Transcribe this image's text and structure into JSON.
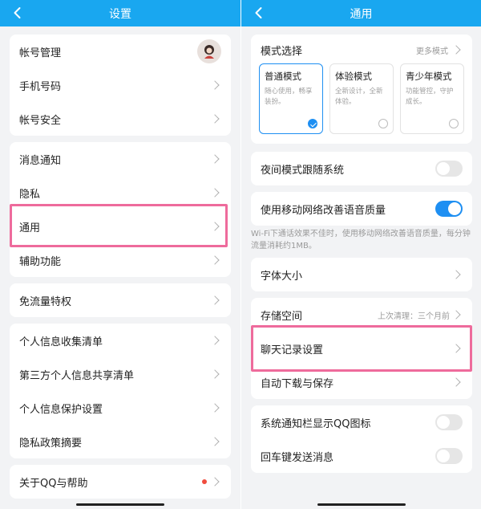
{
  "left": {
    "title": "设置",
    "groups": [
      {
        "items": [
          {
            "label": "帐号管理"
          },
          {
            "label": "手机号码"
          },
          {
            "label": "帐号安全"
          }
        ]
      },
      {
        "items": [
          {
            "label": "消息通知"
          },
          {
            "label": "隐私"
          },
          {
            "label": "通用"
          },
          {
            "label": "辅助功能"
          }
        ]
      },
      {
        "items": [
          {
            "label": "免流量特权"
          }
        ]
      },
      {
        "items": [
          {
            "label": "个人信息收集清单"
          },
          {
            "label": "第三方个人信息共享清单"
          },
          {
            "label": "个人信息保护设置"
          },
          {
            "label": "隐私政策摘要"
          }
        ]
      },
      {
        "items": [
          {
            "label": "关于QQ与帮助",
            "badge": "red-dot"
          }
        ]
      }
    ]
  },
  "right": {
    "title": "通用",
    "mode": {
      "label": "模式选择",
      "more": "更多模式",
      "cards": [
        {
          "title": "普通模式",
          "desc": "随心使用，畅享装扮。",
          "selected": true
        },
        {
          "title": "体验模式",
          "desc": "全新设计，全新体验。",
          "selected": false
        },
        {
          "title": "青少年模式",
          "desc": "功能管控，守护成长。",
          "selected": false
        }
      ]
    },
    "night_mode": {
      "label": "夜间模式跟随系统",
      "on": false
    },
    "mobile_voice": {
      "label": "使用移动网络改善语音质量",
      "on": true
    },
    "mobile_voice_note": "Wi-Fi下通话效果不佳时，使用移动网络改善语音质量，每分钟流量消耗约1MB。",
    "font_size": {
      "label": "字体大小"
    },
    "storage": {
      "label": "存储空间",
      "hint": "上次清理：三个月前"
    },
    "chat_history": {
      "label": "聊天记录设置"
    },
    "auto_download": {
      "label": "自动下载与保存"
    },
    "notif_icon": {
      "label": "系统通知栏显示QQ图标",
      "on": false
    },
    "enter_send": {
      "label": "回车键发送消息",
      "on": false
    }
  },
  "colors": {
    "titlebar": "#19a7f0",
    "accent": "#1e8ff2",
    "highlight": "#ee6b9c",
    "badge": "#f04c3e"
  }
}
